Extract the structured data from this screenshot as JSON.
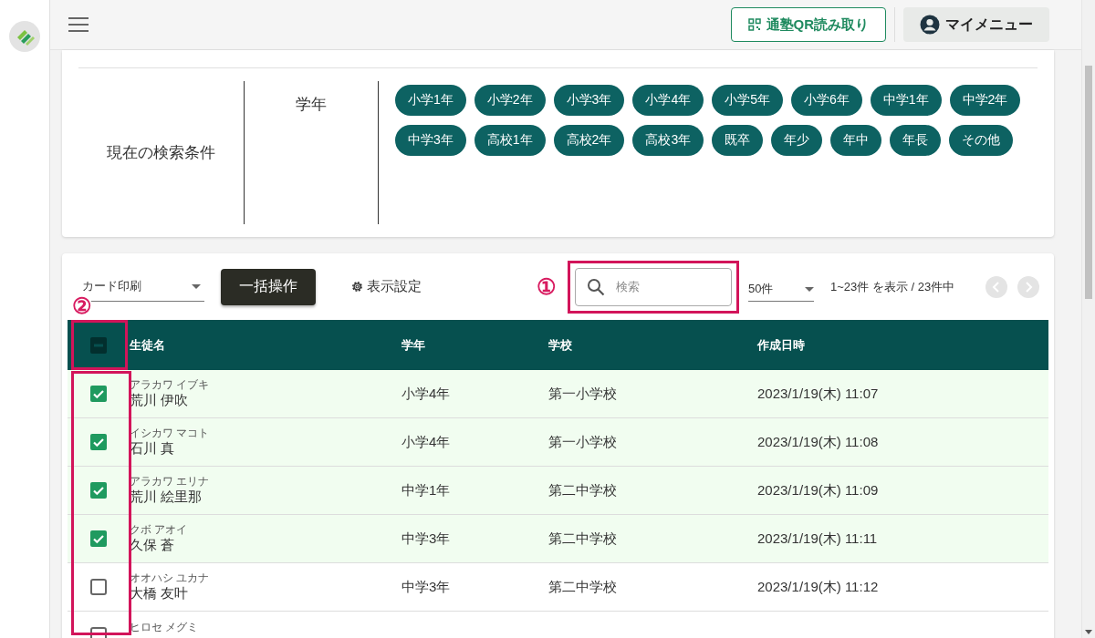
{
  "header": {
    "qr_button": "通塾QR読み取り",
    "menu_button": "マイメニュー"
  },
  "filter": {
    "title": "現在の検索条件",
    "label": "学年",
    "chips": [
      "小学1年",
      "小学2年",
      "小学3年",
      "小学4年",
      "小学5年",
      "小学6年",
      "中学1年",
      "中学2年",
      "中学3年",
      "高校1年",
      "高校2年",
      "高校3年",
      "既卒",
      "年少",
      "年中",
      "年長",
      "その他"
    ]
  },
  "toolbar": {
    "card_select": "カード印刷",
    "bulk_button": "一括操作",
    "settings_link": "表示設定",
    "search": {
      "placeholder": "検索"
    },
    "page_size": "50件",
    "range": "1~23件 を表示 / 23件中"
  },
  "table": {
    "select_all": {
      "indeterminate": true
    },
    "columns": [
      "生徒名",
      "学年",
      "学校",
      "作成日時"
    ],
    "rows": [
      {
        "kana": "アラカワ イブキ",
        "name": "荒川 伊吹",
        "grade": "小学4年",
        "school": "第一小学校",
        "created": "2023/1/19(木) 11:07",
        "checked": true
      },
      {
        "kana": "イシカワ マコト",
        "name": "石川 真",
        "grade": "小学4年",
        "school": "第一小学校",
        "created": "2023/1/19(木) 11:08",
        "checked": true
      },
      {
        "kana": "アラカワ エリナ",
        "name": "荒川 絵里那",
        "grade": "中学1年",
        "school": "第二中学校",
        "created": "2023/1/19(木) 11:09",
        "checked": true
      },
      {
        "kana": "クボ アオイ",
        "name": "久保 蒼",
        "grade": "中学3年",
        "school": "第二中学校",
        "created": "2023/1/19(木) 11:11",
        "checked": true
      },
      {
        "kana": "オオハシ ユカナ",
        "name": "大橋 友叶",
        "grade": "中学3年",
        "school": "第二中学校",
        "created": "2023/1/19(木) 11:12",
        "checked": false
      },
      {
        "kana": "ヒロセ メグミ",
        "checked": false
      }
    ]
  },
  "annotations": [
    {
      "label": "①"
    },
    {
      "label": "②"
    }
  ]
}
